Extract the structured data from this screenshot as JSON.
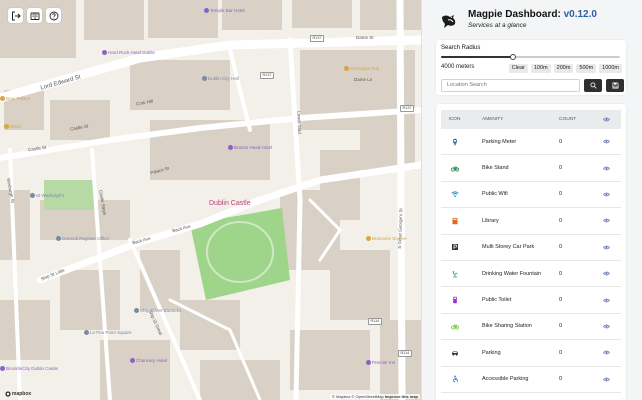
{
  "map": {
    "buttons": [
      {
        "name": "logout-icon"
      },
      {
        "name": "book-icon"
      },
      {
        "name": "help-icon"
      }
    ],
    "streets": [
      {
        "text": "Dame St"
      },
      {
        "text": "Dame Ln"
      },
      {
        "text": "Lord Edward St"
      },
      {
        "text": "Castle St"
      },
      {
        "text": "Cork Hill"
      },
      {
        "text": "Castle St"
      },
      {
        "text": "Werburgh St"
      },
      {
        "text": "Castle Steps"
      },
      {
        "text": "Palace St"
      },
      {
        "text": "Back Ave"
      },
      {
        "text": "Back Ave"
      },
      {
        "text": "Ship St Little"
      },
      {
        "text": "Ship St Great"
      },
      {
        "text": "Lower Yard"
      },
      {
        "text": "S Great George's St"
      }
    ],
    "shields": [
      {
        "text": "R137"
      },
      {
        "text": "R137"
      },
      {
        "text": "R137"
      },
      {
        "text": "R114"
      },
      {
        "text": "R114"
      }
    ],
    "pois": [
      {
        "text": "Temple Bar Hotel",
        "color": "#8b62c2"
      },
      {
        "text": "Hard Rock Hotel Dublin",
        "color": "#8b62c2"
      },
      {
        "text": "Dublin City Hall",
        "color": "#7b8aa0"
      },
      {
        "text": "Kennedys Pub",
        "color": "#d9a441"
      },
      {
        "text": "Brazen Head Hotel",
        "color": "#8b62c2"
      },
      {
        "text": "Bray Palace",
        "color": "#d9a441"
      },
      {
        "text": "St Werburgh's",
        "color": "#7b8aa0"
      },
      {
        "text": "General Register Office",
        "color": "#7b8aa0"
      },
      {
        "text": "Ship Street Barracks",
        "color": "#7b8aa0"
      },
      {
        "text": "Le Peu Point Square",
        "color": "#7b8aa0"
      },
      {
        "text": "Chancery Hotel",
        "color": "#8b62c2"
      },
      {
        "text": "BrooklinCity Dublin Castle",
        "color": "#8b62c2"
      },
      {
        "text": "Brasserie Square",
        "color": "#d9a441"
      },
      {
        "text": "Premier Inn",
        "color": "#8b62c2"
      },
      {
        "text": "Bistro",
        "color": "#d9a441"
      }
    ],
    "castle_label": "Dublin Castle",
    "logo_text": "mapbox",
    "attribution_prefix": "© Mapbox © OpenStreetMap",
    "attribution_link": "Improve this map"
  },
  "header": {
    "title": "Magpie Dashboard:",
    "version": "v0.12.0",
    "subtitle": "Services at a glance"
  },
  "search_card": {
    "radius_label": "Search Radius",
    "radius_value": 0.4,
    "meters_text": "4000 meters",
    "presets": [
      "Clear",
      "100m",
      "200m",
      "500m",
      "1000m"
    ],
    "search_placeholder": "Location Search"
  },
  "table": {
    "headers": {
      "icon": "ICON",
      "amenity": "AMENITY",
      "count": "COUNT"
    },
    "rows": [
      {
        "icon": "parking-meter-icon",
        "color": "#3b5db0",
        "amenity": "Parking Meter",
        "count": "0"
      },
      {
        "icon": "bike-stand-icon",
        "color": "#2e8b57",
        "amenity": "Bike Stand",
        "count": "0"
      },
      {
        "icon": "wifi-icon",
        "color": "#1b7fb8",
        "amenity": "Public Wifi",
        "count": "0"
      },
      {
        "icon": "library-icon",
        "color": "#e06b1f",
        "amenity": "Library",
        "count": "0"
      },
      {
        "icon": "car-park-icon",
        "color": "#333333",
        "amenity": "Multi Storey Car Park",
        "count": "0"
      },
      {
        "icon": "water-fountain-icon",
        "color": "#1fa5a5",
        "amenity": "Drinking Water Fountain",
        "count": "0"
      },
      {
        "icon": "toilet-icon",
        "color": "#9b30c8",
        "amenity": "Public Toilet",
        "count": "0"
      },
      {
        "icon": "bike-sharing-icon",
        "color": "#7ac943",
        "amenity": "Bike Sharing Station",
        "count": "0"
      },
      {
        "icon": "car-icon",
        "color": "#333333",
        "amenity": "Parking",
        "count": "0"
      },
      {
        "icon": "accessible-icon",
        "color": "#2a6fd1",
        "amenity": "Accessible Parking",
        "count": "0"
      }
    ]
  },
  "colors": {
    "accent": "#2b5fa6",
    "dark_button": "#2d2f31",
    "eye_icon": "#5a6ea8"
  }
}
